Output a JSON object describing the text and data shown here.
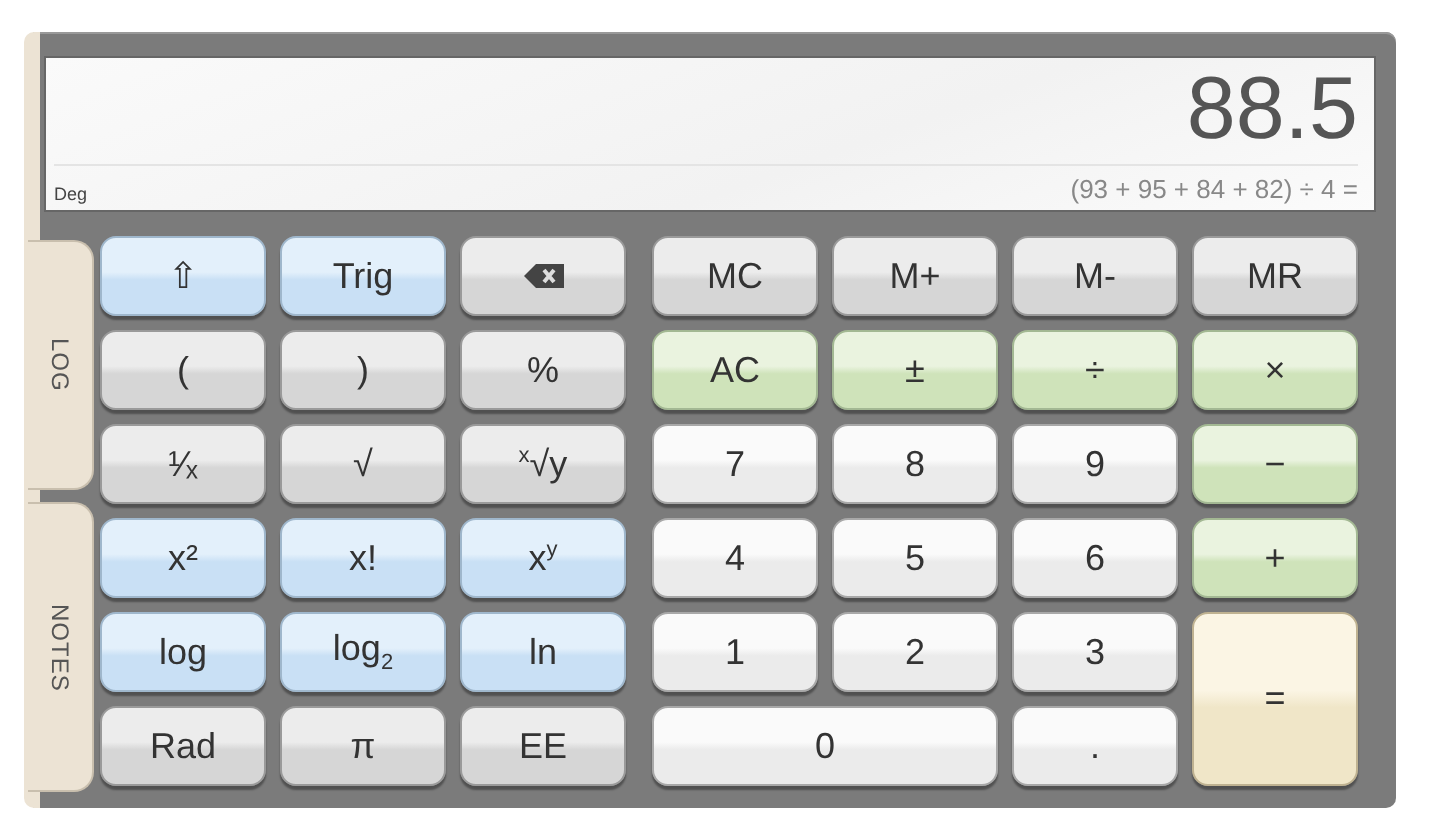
{
  "display": {
    "mode": "Deg",
    "value": "88.5",
    "expression": "(93 + 95 + 84 + 82) ÷ 4 ="
  },
  "side_tabs": [
    {
      "label": "LOG",
      "selected": false
    },
    {
      "label": "NOTES",
      "selected": false
    }
  ],
  "scientific_keys": [
    {
      "label": "⇧",
      "kind": "function"
    },
    {
      "label": "Trig",
      "kind": "function"
    },
    {
      "kind": "clear"
    },
    {
      "label": "(",
      "kind": "plain"
    },
    {
      "label": ")",
      "kind": "plain"
    },
    {
      "label": "%",
      "kind": "plain"
    },
    {
      "label": "¹⁄ₓ",
      "kind": "plain"
    },
    {
      "label": "√",
      "kind": "plain"
    },
    {
      "label": "$^{x}$√y",
      "kind": "plain"
    },
    {
      "label": "x²",
      "kind": "function"
    },
    {
      "label": "x!",
      "kind": "function"
    },
    {
      "label": "x$^{y}$",
      "kind": "function"
    },
    {
      "label": "log",
      "kind": "function"
    },
    {
      "label": "log$_{2}$",
      "kind": "function"
    },
    {
      "label": "ln",
      "kind": "function"
    },
    {
      "label": "Rad",
      "kind": "plain"
    },
    {
      "label": "π",
      "kind": "plain"
    },
    {
      "label": "EE",
      "kind": "plain"
    }
  ],
  "standard_keys": [
    {
      "label": "MC",
      "kind": "plain"
    },
    {
      "label": "M+",
      "kind": "plain"
    },
    {
      "label": "M-",
      "kind": "plain"
    },
    {
      "label": "MR",
      "kind": "plain"
    },
    {
      "label": "AC",
      "kind": "operator"
    },
    {
      "label": "±",
      "kind": "operator"
    },
    {
      "label": "÷",
      "kind": "operator"
    },
    {
      "label": "×",
      "kind": "operator"
    },
    {
      "label": "7",
      "kind": "digit"
    },
    {
      "label": "8",
      "kind": "digit"
    },
    {
      "label": "9",
      "kind": "digit"
    },
    {
      "label": "−",
      "kind": "operator"
    },
    {
      "label": "4",
      "kind": "digit"
    },
    {
      "label": "5",
      "kind": "digit"
    },
    {
      "label": "6",
      "kind": "digit"
    },
    {
      "label": "+",
      "kind": "operator"
    },
    {
      "label": "1",
      "kind": "digit"
    },
    {
      "label": "2",
      "kind": "digit"
    },
    {
      "label": "3",
      "kind": "digit"
    },
    {
      "label": "=",
      "kind": "equals",
      "tall": true
    },
    {
      "label": "0",
      "kind": "digit",
      "wide": true
    },
    {
      "label": ".",
      "kind": "digit"
    }
  ]
}
